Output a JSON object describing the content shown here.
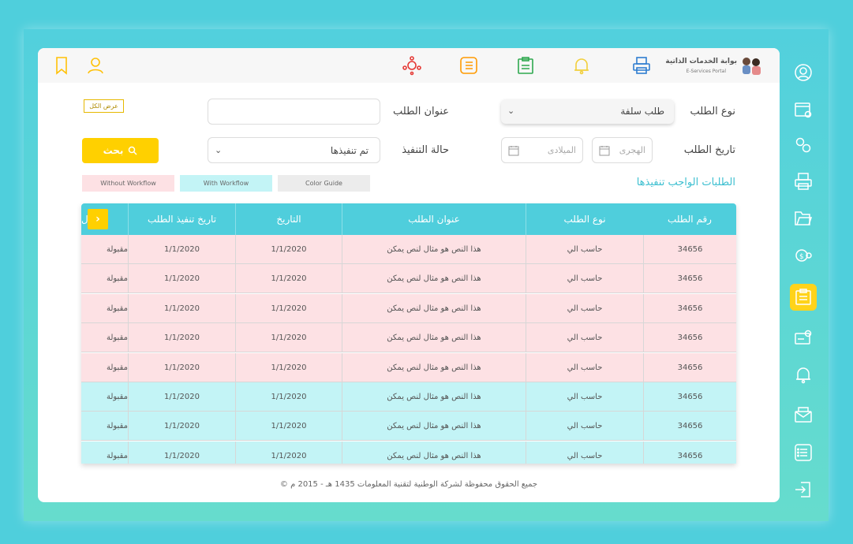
{
  "header": {
    "logo_title": "بوابة الخدمات الذاتية",
    "logo_subtitle": "E-Services Portal"
  },
  "icons": {
    "top": [
      "portal-logo-icon",
      "printer-icon",
      "bell-question-icon",
      "clipboard-icon",
      "list-icon",
      "network-icon",
      "user-icon",
      "bookmark-icon"
    ],
    "sidebar": [
      "dashboard-icon",
      "calendar-settings-icon",
      "gears-icon",
      "printer-icon",
      "folder-icon",
      "money-settings-icon",
      "clipboard-icon",
      "card-settings-icon",
      "bell-question-icon",
      "mail-icon",
      "list-icon",
      "logout-icon"
    ]
  },
  "colors": {
    "accent": "#4fcedc",
    "button": "#ffd000",
    "row_without_workflow": "#fde1e4",
    "row_with_workflow": "#c3f4f6",
    "color_guide": "#ededed"
  },
  "form": {
    "request_type_label": "نوع الطلب",
    "request_type_value": "طلب سلفة",
    "request_title_label": "عنوان الطلب",
    "request_title_value": "",
    "request_date_label": "تاريخ الطلب",
    "hijri_placeholder": "الهجرى",
    "gregorian_placeholder": "الميلادى",
    "execution_status_label": "حالة التنفيذ",
    "execution_status_value": "تم تنفيذها",
    "search_button": "بحث",
    "show_all_button": "عرض الكل"
  },
  "legend": {
    "color_guide": "Color Guide",
    "with_workflow": "With Workflow",
    "without_workflow": "Without Workflow"
  },
  "section_title": "الطلبات الواجب تنفيذها",
  "table": {
    "columns": [
      "رقم الطلب",
      "نوع الطلب",
      "عنوان الطلب",
      "التاريخ",
      "تاريخ تنفيذ الطلب",
      "الحالة"
    ],
    "visible_last_header": "ال",
    "rows": [
      {
        "number": "34656",
        "type": "حاسب الي",
        "title": "هذا النص هو مثال لنص يمكن",
        "date": "1/1/2020",
        "exec_date": "1/1/2020",
        "status": "مقبولة",
        "workflow": false
      },
      {
        "number": "34656",
        "type": "حاسب الي",
        "title": "هذا النص هو مثال لنص يمكن",
        "date": "1/1/2020",
        "exec_date": "1/1/2020",
        "status": "مقبولة",
        "workflow": false
      },
      {
        "number": "34656",
        "type": "حاسب الي",
        "title": "هذا النص هو مثال لنص يمكن",
        "date": "1/1/2020",
        "exec_date": "1/1/2020",
        "status": "مقبولة",
        "workflow": false
      },
      {
        "number": "34656",
        "type": "حاسب الي",
        "title": "هذا النص هو مثال لنص يمكن",
        "date": "1/1/2020",
        "exec_date": "1/1/2020",
        "status": "مقبولة",
        "workflow": false
      },
      {
        "number": "34656",
        "type": "حاسب الي",
        "title": "هذا النص هو مثال لنص يمكن",
        "date": "1/1/2020",
        "exec_date": "1/1/2020",
        "status": "مقبولة",
        "workflow": false
      },
      {
        "number": "34656",
        "type": "حاسب الي",
        "title": "هذا النص هو مثال لنص يمكن",
        "date": "1/1/2020",
        "exec_date": "1/1/2020",
        "status": "مقبولة",
        "workflow": true
      },
      {
        "number": "34656",
        "type": "حاسب الي",
        "title": "هذا النص هو مثال لنص يمكن",
        "date": "1/1/2020",
        "exec_date": "1/1/2020",
        "status": "مقبولة",
        "workflow": true
      },
      {
        "number": "34656",
        "type": "حاسب الي",
        "title": "هذا النص هو مثال لنص يمكن",
        "date": "1/1/2020",
        "exec_date": "1/1/2020",
        "status": "مقبولة",
        "workflow": true
      }
    ]
  },
  "footer": "جميع الحقوق محفوظة لشركة الوطنية لتقنية المعلومات 1435 هـ - 2015 م ©"
}
